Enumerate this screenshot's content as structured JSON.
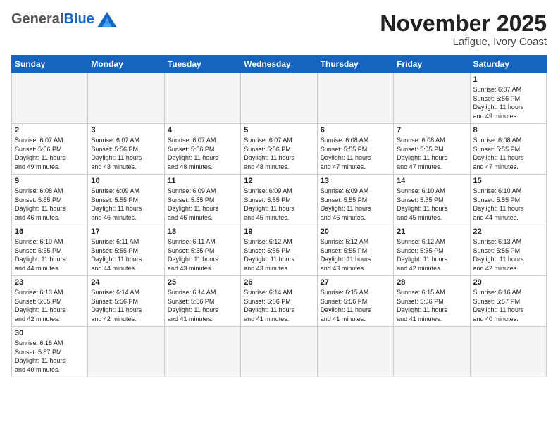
{
  "header": {
    "logo_general": "General",
    "logo_blue": "Blue",
    "month_title": "November 2025",
    "location": "Lafigue, Ivory Coast"
  },
  "days_of_week": [
    "Sunday",
    "Monday",
    "Tuesday",
    "Wednesday",
    "Thursday",
    "Friday",
    "Saturday"
  ],
  "weeks": [
    [
      {
        "day": "",
        "info": ""
      },
      {
        "day": "",
        "info": ""
      },
      {
        "day": "",
        "info": ""
      },
      {
        "day": "",
        "info": ""
      },
      {
        "day": "",
        "info": ""
      },
      {
        "day": "",
        "info": ""
      },
      {
        "day": "1",
        "info": "Sunrise: 6:07 AM\nSunset: 5:56 PM\nDaylight: 11 hours\nand 49 minutes."
      }
    ],
    [
      {
        "day": "2",
        "info": "Sunrise: 6:07 AM\nSunset: 5:56 PM\nDaylight: 11 hours\nand 49 minutes."
      },
      {
        "day": "3",
        "info": "Sunrise: 6:07 AM\nSunset: 5:56 PM\nDaylight: 11 hours\nand 48 minutes."
      },
      {
        "day": "4",
        "info": "Sunrise: 6:07 AM\nSunset: 5:56 PM\nDaylight: 11 hours\nand 48 minutes."
      },
      {
        "day": "5",
        "info": "Sunrise: 6:07 AM\nSunset: 5:56 PM\nDaylight: 11 hours\nand 48 minutes."
      },
      {
        "day": "6",
        "info": "Sunrise: 6:08 AM\nSunset: 5:55 PM\nDaylight: 11 hours\nand 47 minutes."
      },
      {
        "day": "7",
        "info": "Sunrise: 6:08 AM\nSunset: 5:55 PM\nDaylight: 11 hours\nand 47 minutes."
      },
      {
        "day": "8",
        "info": "Sunrise: 6:08 AM\nSunset: 5:55 PM\nDaylight: 11 hours\nand 47 minutes."
      }
    ],
    [
      {
        "day": "9",
        "info": "Sunrise: 6:08 AM\nSunset: 5:55 PM\nDaylight: 11 hours\nand 46 minutes."
      },
      {
        "day": "10",
        "info": "Sunrise: 6:09 AM\nSunset: 5:55 PM\nDaylight: 11 hours\nand 46 minutes."
      },
      {
        "day": "11",
        "info": "Sunrise: 6:09 AM\nSunset: 5:55 PM\nDaylight: 11 hours\nand 46 minutes."
      },
      {
        "day": "12",
        "info": "Sunrise: 6:09 AM\nSunset: 5:55 PM\nDaylight: 11 hours\nand 45 minutes."
      },
      {
        "day": "13",
        "info": "Sunrise: 6:09 AM\nSunset: 5:55 PM\nDaylight: 11 hours\nand 45 minutes."
      },
      {
        "day": "14",
        "info": "Sunrise: 6:10 AM\nSunset: 5:55 PM\nDaylight: 11 hours\nand 45 minutes."
      },
      {
        "day": "15",
        "info": "Sunrise: 6:10 AM\nSunset: 5:55 PM\nDaylight: 11 hours\nand 44 minutes."
      }
    ],
    [
      {
        "day": "16",
        "info": "Sunrise: 6:10 AM\nSunset: 5:55 PM\nDaylight: 11 hours\nand 44 minutes."
      },
      {
        "day": "17",
        "info": "Sunrise: 6:11 AM\nSunset: 5:55 PM\nDaylight: 11 hours\nand 44 minutes."
      },
      {
        "day": "18",
        "info": "Sunrise: 6:11 AM\nSunset: 5:55 PM\nDaylight: 11 hours\nand 43 minutes."
      },
      {
        "day": "19",
        "info": "Sunrise: 6:12 AM\nSunset: 5:55 PM\nDaylight: 11 hours\nand 43 minutes."
      },
      {
        "day": "20",
        "info": "Sunrise: 6:12 AM\nSunset: 5:55 PM\nDaylight: 11 hours\nand 43 minutes."
      },
      {
        "day": "21",
        "info": "Sunrise: 6:12 AM\nSunset: 5:55 PM\nDaylight: 11 hours\nand 42 minutes."
      },
      {
        "day": "22",
        "info": "Sunrise: 6:13 AM\nSunset: 5:55 PM\nDaylight: 11 hours\nand 42 minutes."
      }
    ],
    [
      {
        "day": "23",
        "info": "Sunrise: 6:13 AM\nSunset: 5:55 PM\nDaylight: 11 hours\nand 42 minutes."
      },
      {
        "day": "24",
        "info": "Sunrise: 6:14 AM\nSunset: 5:56 PM\nDaylight: 11 hours\nand 42 minutes."
      },
      {
        "day": "25",
        "info": "Sunrise: 6:14 AM\nSunset: 5:56 PM\nDaylight: 11 hours\nand 41 minutes."
      },
      {
        "day": "26",
        "info": "Sunrise: 6:14 AM\nSunset: 5:56 PM\nDaylight: 11 hours\nand 41 minutes."
      },
      {
        "day": "27",
        "info": "Sunrise: 6:15 AM\nSunset: 5:56 PM\nDaylight: 11 hours\nand 41 minutes."
      },
      {
        "day": "28",
        "info": "Sunrise: 6:15 AM\nSunset: 5:56 PM\nDaylight: 11 hours\nand 41 minutes."
      },
      {
        "day": "29",
        "info": "Sunrise: 6:16 AM\nSunset: 5:57 PM\nDaylight: 11 hours\nand 40 minutes."
      }
    ],
    [
      {
        "day": "30",
        "info": "Sunrise: 6:16 AM\nSunset: 5:57 PM\nDaylight: 11 hours\nand 40 minutes."
      },
      {
        "day": "",
        "info": ""
      },
      {
        "day": "",
        "info": ""
      },
      {
        "day": "",
        "info": ""
      },
      {
        "day": "",
        "info": ""
      },
      {
        "day": "",
        "info": ""
      },
      {
        "day": "",
        "info": ""
      }
    ]
  ]
}
